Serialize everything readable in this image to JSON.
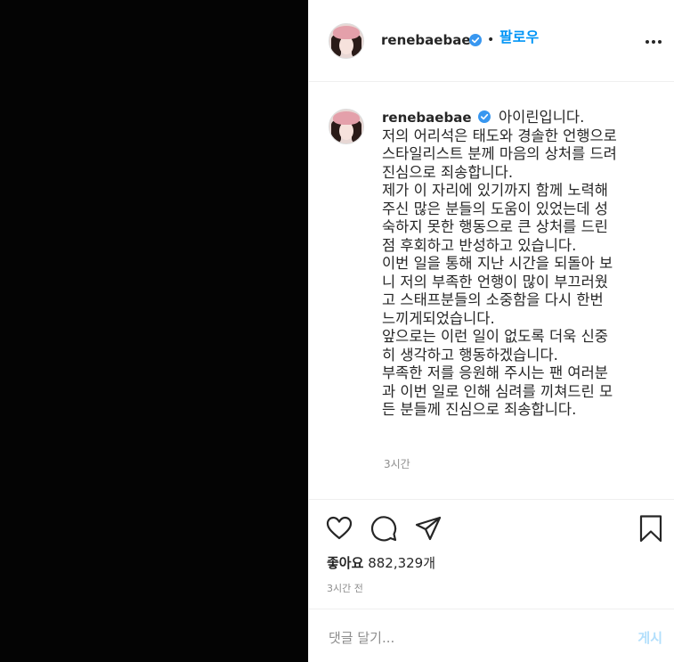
{
  "post": {
    "username": "renebaebae",
    "follow_label": "팔로우",
    "separator": "•",
    "caption_lines": [
      "아이린입니다.",
      "저의 어리석은 태도와 경솔한 언행으로",
      "스타일리스트 분께 마음의 상처를 드려",
      "진심으로 죄송합니다.",
      "제가 이 자리에 있기까지 함께 노력해",
      "주신 많은 분들의 도움이 있었는데 성",
      "숙하지 못한 행동으로 큰 상처를 드린",
      "점 후회하고 반성하고 있습니다.",
      "이번 일을 통해 지난 시간을 되돌아 보",
      "니 저의 부족한 언행이 많이 부끄러웠",
      "고 스태프분들의 소중함을 다시 한번",
      "느끼게되었습니다.",
      "앞으로는 이런 일이 없도록 더욱 신중",
      "히 생각하고 행동하겠습니다.",
      "부족한 저를 응원해 주시는 팬 여러분",
      "과 이번 일로 인해 심려를 끼쳐드린 모",
      "든 분들께 진심으로 죄송합니다."
    ],
    "caption_time": "3시간",
    "likes_label": "좋아요",
    "likes_count": "882,329개",
    "post_time": "3시간 전"
  },
  "comment": {
    "placeholder": "댓글 달기...",
    "post_label": "게시"
  },
  "colors": {
    "accent": "#0095f6",
    "verified": "#3897f0",
    "post_disabled": "#b2dffc"
  },
  "icons": [
    "verified-badge-icon",
    "more-options-icon",
    "heart-icon",
    "comment-icon",
    "share-icon",
    "bookmark-icon"
  ]
}
